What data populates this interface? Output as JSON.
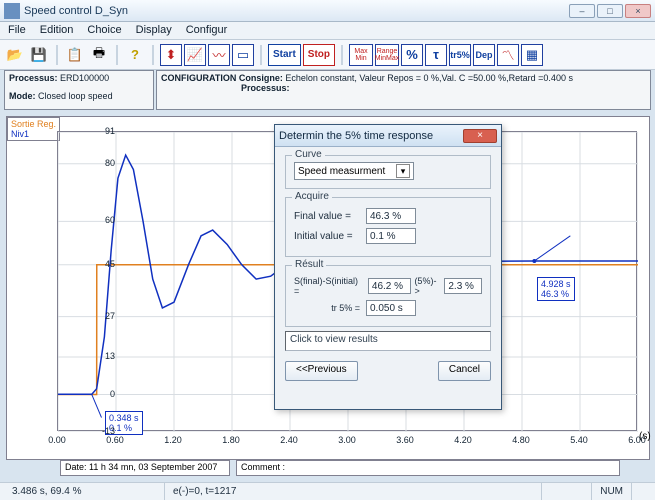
{
  "window": {
    "title": "Speed control D_Syn",
    "min_icon": "–",
    "max_icon": "□",
    "close_icon": "×"
  },
  "menu": [
    "File",
    "Edition",
    "Choice",
    "Display",
    "Configur"
  ],
  "toolbar": {
    "start": "Start",
    "stop": "Stop",
    "maxmin": "Max\nMin",
    "range": "Range\nMinMax",
    "percent": "%",
    "tau": "τ",
    "tr5": "tr5%",
    "dep": "Dep"
  },
  "info_left": {
    "processus_label": "Processus:",
    "processus_value": "ERD100000",
    "mode_label": "Mode:",
    "mode_value": "Closed loop speed"
  },
  "info_right": {
    "config_label": "CONFIGURATION",
    "consigne_label": "Consigne:",
    "consigne_value": "Echelon constant, Valeur Repos = 0 %,Val. C =50.00 %,Retard =0.400 s",
    "proc_label": "Processus:"
  },
  "legend": {
    "l1": "Sortie Reg.",
    "l2": "Niv1"
  },
  "chart_data": {
    "type": "line",
    "xlabel": "(s)",
    "ylabel": "",
    "xlim": [
      0,
      6
    ],
    "ylim": [
      -13,
      91
    ],
    "yticks": [
      -13,
      0,
      13,
      27,
      45,
      60,
      80,
      91
    ],
    "xticks": [
      0.0,
      0.6,
      1.2,
      1.8,
      2.4,
      3.0,
      3.6,
      4.2,
      4.8,
      5.4,
      6.0
    ],
    "series": [
      {
        "name": "Sortie Reg.",
        "color": "#e08020",
        "points": [
          [
            0.0,
            0
          ],
          [
            0.4,
            0
          ],
          [
            0.401,
            45
          ],
          [
            6.0,
            45
          ]
        ]
      },
      {
        "name": "Niv1",
        "color": "#1030c0",
        "points": [
          [
            0.0,
            0.1
          ],
          [
            0.35,
            0.1
          ],
          [
            0.4,
            2
          ],
          [
            0.48,
            20
          ],
          [
            0.55,
            50
          ],
          [
            0.62,
            75
          ],
          [
            0.7,
            83
          ],
          [
            0.78,
            78
          ],
          [
            0.88,
            60
          ],
          [
            0.98,
            40
          ],
          [
            1.08,
            30
          ],
          [
            1.2,
            32
          ],
          [
            1.35,
            45
          ],
          [
            1.48,
            55
          ],
          [
            1.6,
            57
          ],
          [
            1.75,
            52
          ],
          [
            1.9,
            45
          ],
          [
            2.05,
            40
          ],
          [
            2.2,
            41
          ],
          [
            2.4,
            46
          ],
          [
            2.6,
            48
          ],
          [
            2.8,
            47
          ],
          [
            3.0,
            45
          ],
          [
            3.3,
            44
          ],
          [
            3.6,
            45.5
          ],
          [
            4.0,
            46.5
          ],
          [
            4.5,
            46.2
          ],
          [
            4.93,
            46.3
          ],
          [
            6.0,
            46.3
          ]
        ]
      }
    ],
    "annotations": [
      {
        "x": 0.348,
        "y": 0.1,
        "text1": "0.348 s",
        "text2": "0.1 %"
      },
      {
        "x": 4.928,
        "y": 46.3,
        "text1": "4.928 s",
        "text2": "46.3 %"
      }
    ]
  },
  "bottom": {
    "date": "Date: 11 h 34 mn, 03 September 2007",
    "comment_label": "Comment :",
    "comment_value": ""
  },
  "status": {
    "left": "3.486 s, 69.4 %",
    "mid": "e(-)=0, t=1217",
    "num": "NUM"
  },
  "dialog": {
    "title": "Determin the 5% time response",
    "close": "×",
    "curve_group": "Curve",
    "curve_select": "Speed measurment",
    "acquire_group": "Acquire",
    "final_label": "Final value =",
    "final_value": "46.3 %",
    "initial_label": "Initial value =",
    "initial_value": "0.1 %",
    "result_group": "Résult",
    "diff_label": "S(final)-S(initial) =",
    "diff_value": "46.2 %",
    "five_label": "(5%)->",
    "five_value": "2.3 %",
    "tr_label": "tr 5% =",
    "tr_value": "0.050 s",
    "click_text": "Click to view results",
    "prev_btn": "<<Previous",
    "cancel_btn": "Cancel"
  }
}
